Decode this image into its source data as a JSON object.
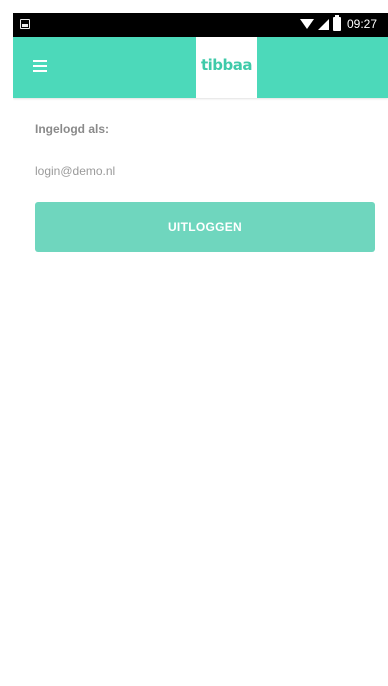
{
  "status_bar": {
    "time": "09:27",
    "icons": [
      "image-icon",
      "wifi-icon",
      "signal-icon",
      "battery-icon"
    ]
  },
  "app_bar": {
    "menu_icon": "hamburger-menu-icon",
    "logo_text": "tibbaa",
    "background_color": "#4cd9ba"
  },
  "account": {
    "logged_in_label": "Ingelogd als:",
    "email": "login@demo.nl",
    "logout_label": "UITLOGGEN",
    "button_color": "#6fd6be"
  }
}
